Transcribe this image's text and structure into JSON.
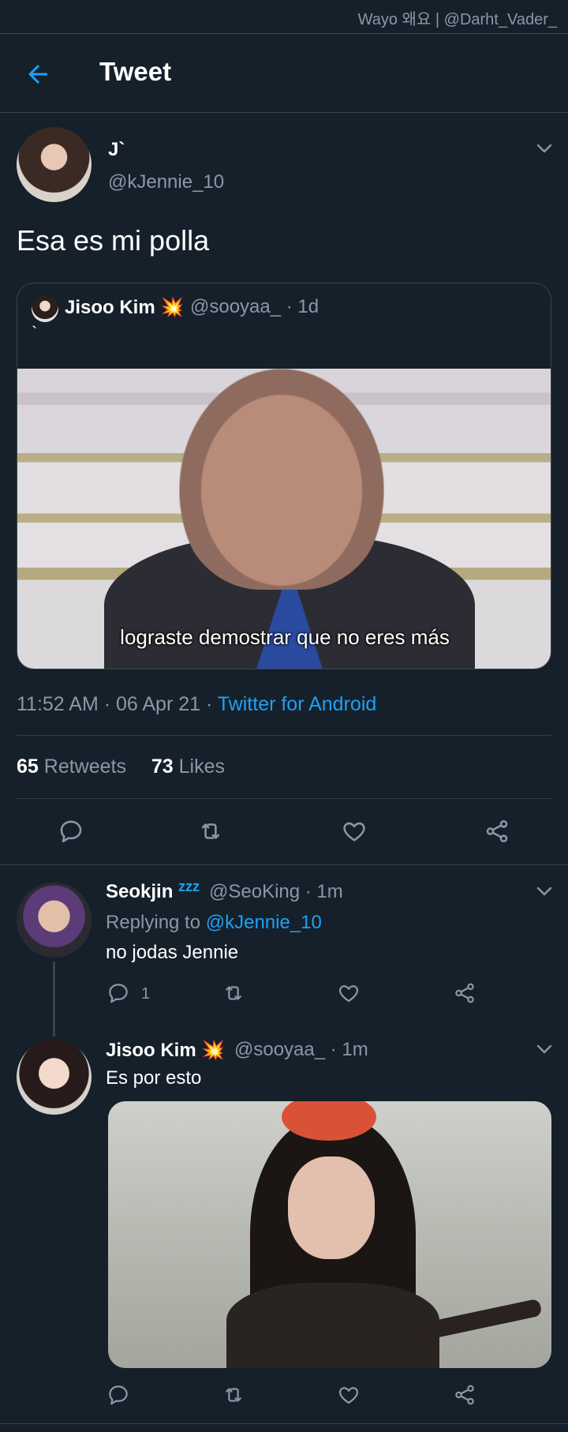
{
  "watermark": "Wayo 왜요 | @Darht_Vader_",
  "header": {
    "title": "Tweet"
  },
  "tweet": {
    "author_name": "J`",
    "author_handle": "@kJennie_10",
    "text": "Esa es mi polla",
    "time": "11:52 AM · 06 Apr 21 · ",
    "client": "Twitter for Android",
    "retweets_count": "65",
    "retweets_label": "Retweets",
    "likes_count": "73",
    "likes_label": "Likes"
  },
  "quote": {
    "name": "Jisoo Kim 💥",
    "handle": "@sooyaa_ · 1d",
    "text": "`",
    "media_caption": "lograste demostrar que no eres más"
  },
  "replies": [
    {
      "name": "Seokjin",
      "badge": "zzz",
      "handle": "@SeoKing · 1m",
      "replying_prefix": "Replying to ",
      "replying_to": "@kJennie_10",
      "text": "no jodas Jennie",
      "reply_count": "1"
    },
    {
      "name": "Jisoo Kim 💥",
      "handle": "@sooyaa_ · 1m",
      "text": "Es por esto"
    }
  ],
  "icons": {
    "back": "arrow-left-icon",
    "more": "chevron-down-icon",
    "reply": "comment-icon",
    "retweet": "retweet-icon",
    "like": "heart-icon",
    "share": "share-icon"
  },
  "colors": {
    "background": "#15202b",
    "accent": "#1da1f2",
    "muted": "#8899a6",
    "divider": "#38444d"
  }
}
